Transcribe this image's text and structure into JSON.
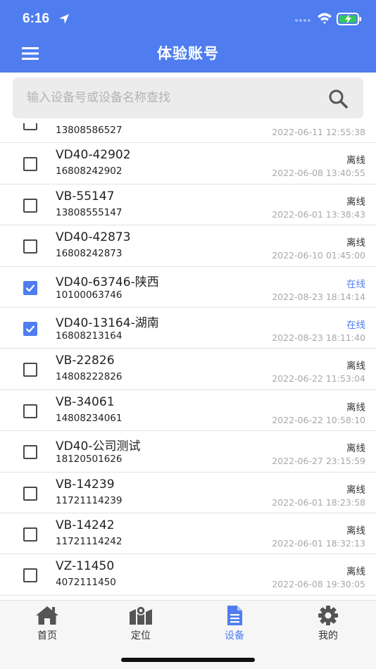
{
  "status_bar": {
    "time": "6:16"
  },
  "header": {
    "title": "体验账号"
  },
  "search": {
    "placeholder": "输入设备号或设备名称查找"
  },
  "devices": [
    {
      "name": "",
      "code": "13808586527",
      "status": "",
      "time": "2022-06-11 12:55:38",
      "checked": false,
      "online": false
    },
    {
      "name": "VD40-42902",
      "code": "16808242902",
      "status": "离线",
      "time": "2022-06-08 13:40:55",
      "checked": false,
      "online": false
    },
    {
      "name": "VB-55147",
      "code": "13808555147",
      "status": "离线",
      "time": "2022-06-01 13:38:43",
      "checked": false,
      "online": false
    },
    {
      "name": "VD40-42873",
      "code": "16808242873",
      "status": "离线",
      "time": "2022-06-10 01:45:00",
      "checked": false,
      "online": false
    },
    {
      "name": "VD40-63746-陕西",
      "code": "10100063746",
      "status": "在线",
      "time": "2022-08-23 18:14:14",
      "checked": true,
      "online": true
    },
    {
      "name": "VD40-13164-湖南",
      "code": "16808213164",
      "status": "在线",
      "time": "2022-08-23 18:11:40",
      "checked": true,
      "online": true
    },
    {
      "name": "VB-22826",
      "code": "14808222826",
      "status": "离线",
      "time": "2022-06-22 11:53:04",
      "checked": false,
      "online": false
    },
    {
      "name": "VB-34061",
      "code": "14808234061",
      "status": "离线",
      "time": "2022-06-22 10:58:10",
      "checked": false,
      "online": false
    },
    {
      "name": "VD40-公司测试",
      "code": "18120501626",
      "status": "离线",
      "time": "2022-06-27 23:15:59",
      "checked": false,
      "online": false
    },
    {
      "name": "VB-14239",
      "code": "11721114239",
      "status": "离线",
      "time": "2022-06-01 18:23:58",
      "checked": false,
      "online": false
    },
    {
      "name": "VB-14242",
      "code": "11721114242",
      "status": "离线",
      "time": "2022-06-01 18:32:13",
      "checked": false,
      "online": false
    },
    {
      "name": "VZ-11450",
      "code": "4072111450",
      "status": "离线",
      "time": "2022-06-08 19:30:05",
      "checked": false,
      "online": false
    }
  ],
  "tabs": [
    {
      "label": "首页",
      "icon": "home-icon",
      "active": false
    },
    {
      "label": "定位",
      "icon": "map-icon",
      "active": false
    },
    {
      "label": "设备",
      "icon": "document-icon",
      "active": true
    },
    {
      "label": "我的",
      "icon": "gear-icon",
      "active": false
    }
  ],
  "colors": {
    "accent": "#4f7df0",
    "offline_text": "#333333",
    "timestamp": "#a8a8a8"
  }
}
